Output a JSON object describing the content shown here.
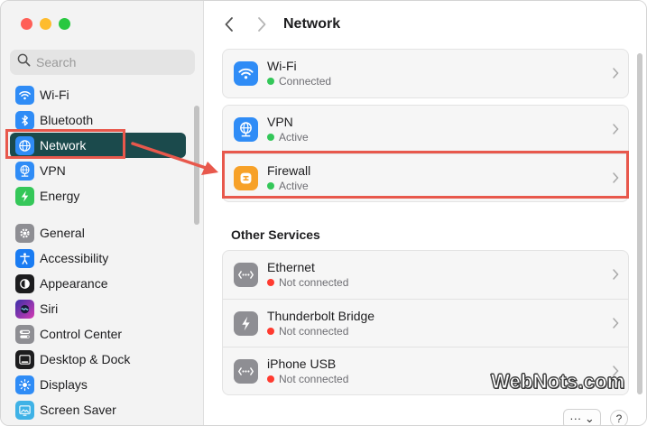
{
  "sidebar": {
    "search_placeholder": "Search",
    "items": [
      {
        "label": "Wi-Fi",
        "icon": "wifi-icon",
        "color": "#2f8cf6"
      },
      {
        "label": "Bluetooth",
        "icon": "bluetooth-icon",
        "color": "#2f8cf6"
      },
      {
        "label": "Network",
        "icon": "globe-icon",
        "color": "#2f8cf6",
        "active": true
      },
      {
        "label": "VPN",
        "icon": "vpn-globe-icon",
        "color": "#2f8cf6"
      },
      {
        "label": "Energy",
        "icon": "bolt-icon",
        "color": "#35c759"
      },
      {
        "label": "General",
        "icon": "gear-icon",
        "color": "#8e8e93"
      },
      {
        "label": "Accessibility",
        "icon": "accessibility-icon",
        "color": "#1a7cf2"
      },
      {
        "label": "Appearance",
        "icon": "appearance-icon",
        "color": "#1c1c1e"
      },
      {
        "label": "Siri",
        "icon": "siri-icon",
        "color": "#5b3fd8"
      },
      {
        "label": "Control Center",
        "icon": "control-center-icon",
        "color": "#8e8e93"
      },
      {
        "label": "Desktop & Dock",
        "icon": "dock-icon",
        "color": "#1c1c1e"
      },
      {
        "label": "Displays",
        "icon": "sun-icon",
        "color": "#2f8cf6"
      },
      {
        "label": "Screen Saver",
        "icon": "screen-saver-icon",
        "color": "#3fb2e6"
      }
    ]
  },
  "main": {
    "title": "Network",
    "groups": [
      {
        "rows": [
          {
            "name": "Wi-Fi",
            "status": "Connected",
            "status_color": "green",
            "icon": "wifi-icon",
            "color": "#2f8cf6"
          }
        ]
      },
      {
        "rows": [
          {
            "name": "VPN",
            "status": "Active",
            "status_color": "green",
            "icon": "vpn-globe-icon",
            "color": "#2f8cf6"
          },
          {
            "name": "Firewall",
            "status": "Active",
            "status_color": "green",
            "icon": "firewall-icon",
            "color": "#f7a128"
          }
        ]
      }
    ],
    "other_services_title": "Other Services",
    "other_rows": [
      {
        "name": "Ethernet",
        "status": "Not connected",
        "status_color": "red",
        "icon": "ethernet-icon",
        "color": "#8e8e93"
      },
      {
        "name": "Thunderbolt Bridge",
        "status": "Not connected",
        "status_color": "red",
        "icon": "thunderbolt-icon",
        "color": "#8e8e93"
      },
      {
        "name": "iPhone USB",
        "status": "Not connected",
        "status_color": "red",
        "icon": "ethernet-icon",
        "color": "#8e8e93"
      }
    ],
    "more_button": "··· ⌄",
    "help_button": "?"
  },
  "watermark": "WebNots.com",
  "colors": {
    "active_sidebar": "#1b4a4c",
    "highlight": "#e8584c"
  }
}
